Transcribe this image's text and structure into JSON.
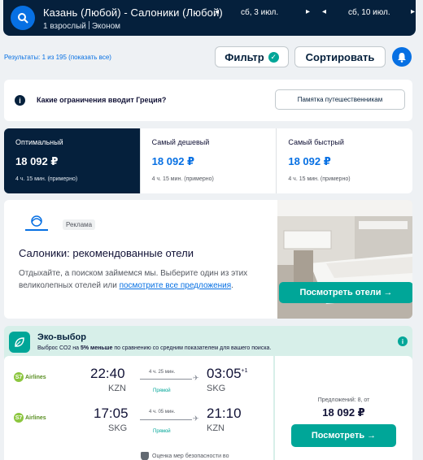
{
  "search": {
    "route": "Казань (Любой) - Салоники (Любой)",
    "passengers": "1 взрослый",
    "cabin": "Эконом",
    "depart_date": "сб, 3 июл.",
    "return_date": "сб, 10 июл.",
    "prev_arrow": "◂",
    "next_arrow": "▸"
  },
  "results": {
    "count_text": "Результаты: 1 из 195 (показать все)",
    "filter_label": "Фильтр",
    "sort_label": "Сортировать"
  },
  "info": {
    "icon": "i",
    "text": "Какие ограничения вводит Греция?",
    "button": "Памятка путешественникам"
  },
  "tabs": [
    {
      "label": "Оптимальный",
      "price": "18 092 ₽",
      "time": "4 ч. 15 мин. (примерно)",
      "active": true
    },
    {
      "label": "Самый дешевый",
      "price": "18 092 ₽",
      "time": "4 ч. 15 мин. (примерно)",
      "active": false
    },
    {
      "label": "Самый быстрый",
      "price": "18 092 ₽",
      "time": "4 ч. 15 мин. (примерно)",
      "active": false
    }
  ],
  "ad": {
    "tag": "Реклама",
    "title": "Салоники: рекомендованные отели",
    "body_prefix": "Отдыхайте, а поиском займемся мы. Выберите один из этих великолепных отелей или ",
    "body_link": "посмотрите все предложения",
    "body_suffix": ".",
    "button": "Посмотреть отели →"
  },
  "eco": {
    "title": "Эко-выбор",
    "subtitle_prefix": "Выброс CO2 на ",
    "subtitle_bold": "5% меньше",
    "subtitle_suffix": " по сравнению со средним показателем для вашего поиска.",
    "info_icon": "i"
  },
  "flights": [
    {
      "airline": "Airlines",
      "airline_mark": "S7",
      "dep_time": "22:40",
      "dep_code": "KZN",
      "duration": "4 ч. 25 мин.",
      "stops": "Прямой",
      "arr_time": "03:05",
      "arr_days": "+1",
      "arr_code": "SKG"
    },
    {
      "airline": "Airlines",
      "airline_mark": "S7",
      "dep_time": "17:05",
      "dep_code": "SKG",
      "duration": "4 ч. 05 мин.",
      "stops": "Прямой",
      "arr_time": "21:10",
      "arr_days": "",
      "arr_code": "KZN"
    }
  ],
  "safety_text": "Оценка мер безопасности во",
  "price_card": {
    "offers": "Предложений: 8, от",
    "price": "18 092 ₽",
    "button": "Посмотреть →"
  },
  "colors": {
    "header_bg": "#05203c",
    "brand_blue": "#0770e3",
    "accent_green": "#00a698",
    "eco_bg": "#d7efe9"
  }
}
